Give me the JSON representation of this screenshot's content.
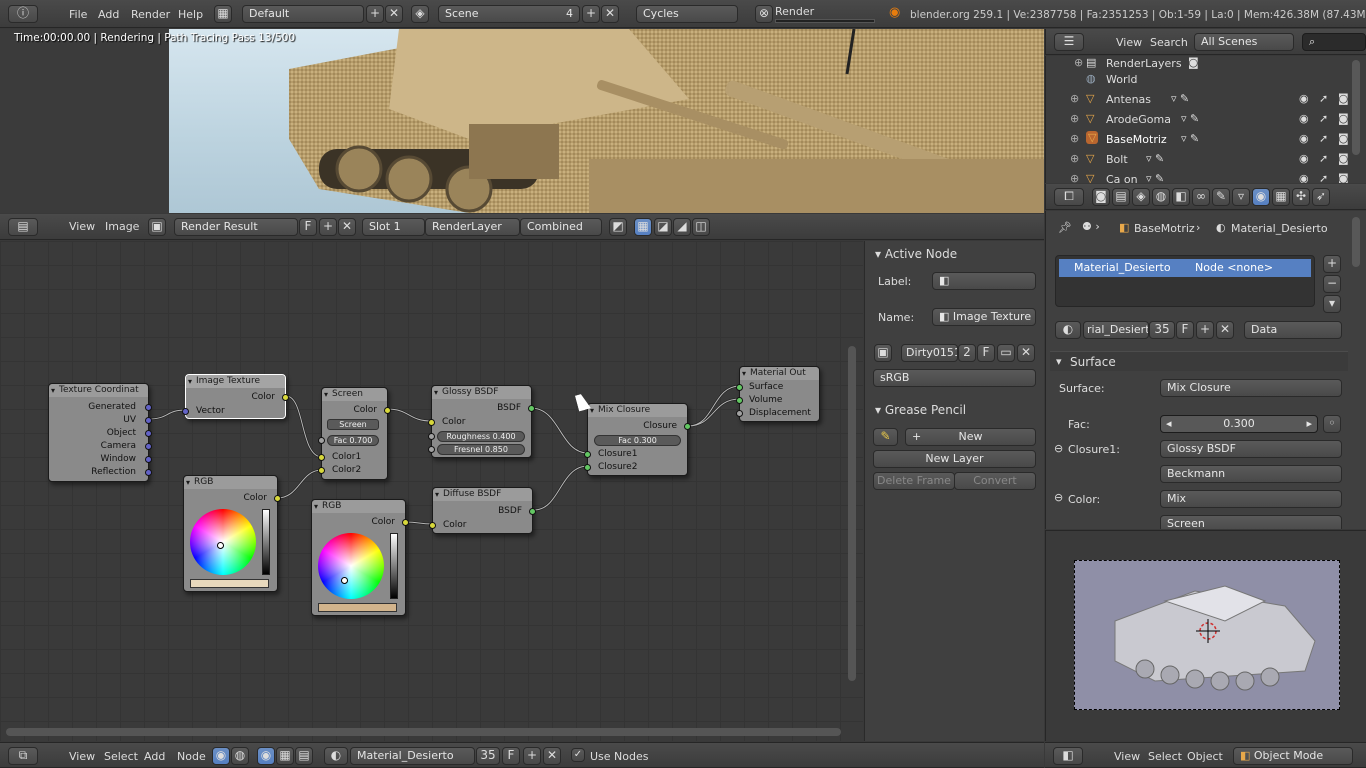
{
  "topbar": {
    "menus": [
      "File",
      "Add",
      "Render",
      "Help"
    ],
    "layout": "Default",
    "scene": "Scene",
    "scene_users": "4",
    "engine": "Cycles",
    "render_job": "Render",
    "stats": "blender.org 259.1 | Ve:2387758 | Fa:2351253 | Ob:1-59 | La:0 | Mem:426.38M (87.43M) | BaseMotriz"
  },
  "render_view": {
    "status": "Time:00:00.00 | Rendering | Path Tracing Pass 13/500"
  },
  "image_header": {
    "menus": [
      "View",
      "Image"
    ],
    "image": "Render Result",
    "fake_user": "F",
    "slot": "Slot 1",
    "layer": "RenderLayer",
    "pass": "Combined"
  },
  "outliner": {
    "menus": [
      "View",
      "Search"
    ],
    "filter": "All Scenes",
    "items": [
      {
        "name": "RenderLayers"
      },
      {
        "name": "World"
      },
      {
        "name": "Antenas"
      },
      {
        "name": "ArodeGoma"
      },
      {
        "name": "BaseMotriz"
      },
      {
        "name": "Bolt"
      },
      {
        "name": "Ca on"
      }
    ]
  },
  "nodes": {
    "texcoord": {
      "title": "Texture Coordinat",
      "outputs": [
        "Generated",
        "UV",
        "Object",
        "Camera",
        "Window",
        "Reflection"
      ]
    },
    "imagetex": {
      "title": "Image Texture",
      "output": "Color",
      "input": "Vector"
    },
    "screen": {
      "title": "Screen",
      "output": "Color",
      "mode": "Screen",
      "fac": "Fac 0.700",
      "inputs": [
        "Color1",
        "Color2"
      ]
    },
    "glossy": {
      "title": "Glossy BSDF",
      "output": "BSDF",
      "input": "Color",
      "roughness": "Roughness 0.400",
      "fresnel": "Fresnel 0.850"
    },
    "diffuse": {
      "title": "Diffuse BSDF",
      "output": "BSDF",
      "input": "Color"
    },
    "mix": {
      "title": "Mix Closure",
      "output": "Closure",
      "fac": "Fac 0.300",
      "inputs": [
        "Closure1",
        "Closure2"
      ]
    },
    "out": {
      "title": "Material Out",
      "inputs": [
        "Surface",
        "Volume",
        "Displacement"
      ]
    },
    "rgb1": {
      "title": "RGB",
      "output": "Color",
      "swatch": "#e8d9bd"
    },
    "rgb2": {
      "title": "RGB",
      "output": "Color",
      "swatch": "#d2b48c"
    }
  },
  "active_node": {
    "title": "Active Node",
    "label_label": "Label:",
    "name_label": "Name:",
    "name": "Image Texture",
    "image": "Dirty0151",
    "users": "2",
    "fake": "F",
    "colorspace": "sRGB"
  },
  "grease_pencil": {
    "title": "Grease Pencil",
    "new": "New",
    "new_layer": "New Layer",
    "delete_frame": "Delete Frame",
    "convert": "Convert"
  },
  "properties": {
    "breadcrumb_obj": "BaseMotriz",
    "breadcrumb_mat": "Material_Desierto",
    "slot_name": "Material_Desierto",
    "slot_node": "Node <none>",
    "mat_field": "rial_Desierto",
    "mat_users": "35",
    "fake": "F",
    "link": "Data",
    "surface_section": "Surface",
    "surface_label": "Surface:",
    "surface": "Mix Closure",
    "fac_label": "Fac:",
    "fac": "0.300",
    "closure1_label": "Closure1:",
    "closure1": "Glossy BSDF",
    "distribution": "Beckmann",
    "color_label": "Color:",
    "color": "Mix",
    "color2": "Screen"
  },
  "viewport": {
    "menus": [
      "View",
      "Select",
      "Object"
    ],
    "mode": "Object Mode"
  },
  "node_footer": {
    "menus": [
      "View",
      "Select",
      "Add",
      "Node"
    ],
    "material": "Material_Desierto",
    "users": "35",
    "fake": "F",
    "use_nodes": "Use Nodes"
  },
  "colors": {
    "accent": "#5680c2",
    "selected_row": "#5680c2",
    "background": "#393939",
    "node_grid": "#3a3a3a"
  }
}
